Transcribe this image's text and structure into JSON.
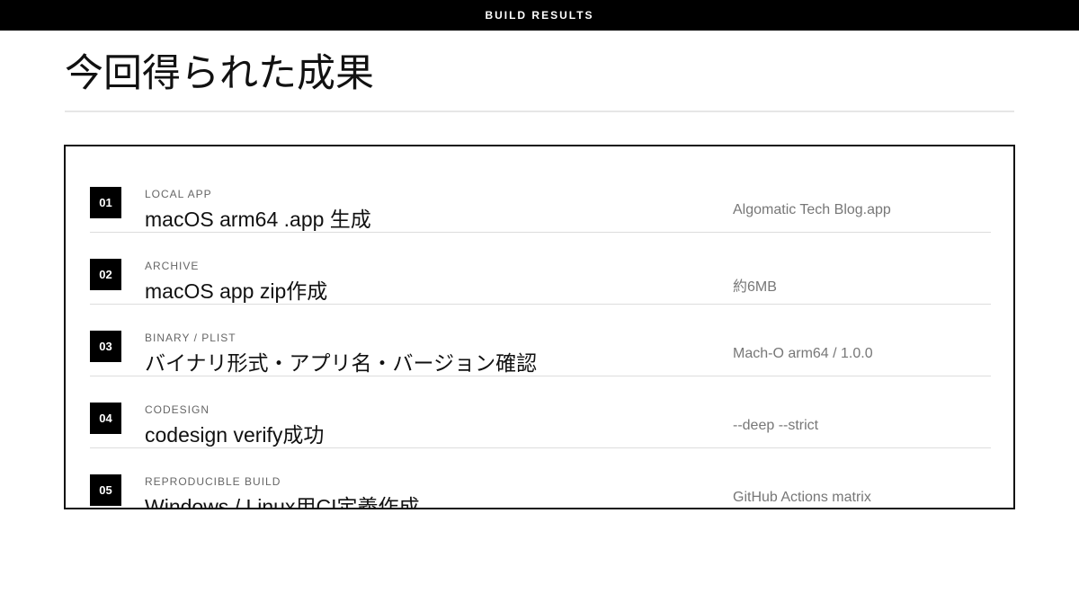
{
  "header": {
    "label": "BUILD RESULTS"
  },
  "page": {
    "title": "今回得られた成果"
  },
  "results": [
    {
      "number": "01",
      "category": "LOCAL APP",
      "title": "macOS arm64 .app 生成",
      "detail": "Algomatic Tech Blog.app"
    },
    {
      "number": "02",
      "category": "ARCHIVE",
      "title": "macOS app zip作成",
      "detail": "約6MB"
    },
    {
      "number": "03",
      "category": "BINARY / PLIST",
      "title": "バイナリ形式・アプリ名・バージョン確認",
      "detail": "Mach-O arm64 / 1.0.0"
    },
    {
      "number": "04",
      "category": "CODESIGN",
      "title": "codesign verify成功",
      "detail": "--deep --strict"
    },
    {
      "number": "05",
      "category": "REPRODUCIBLE BUILD",
      "title": "Windows / Linux用CI定義作成",
      "detail": "GitHub Actions matrix"
    }
  ]
}
